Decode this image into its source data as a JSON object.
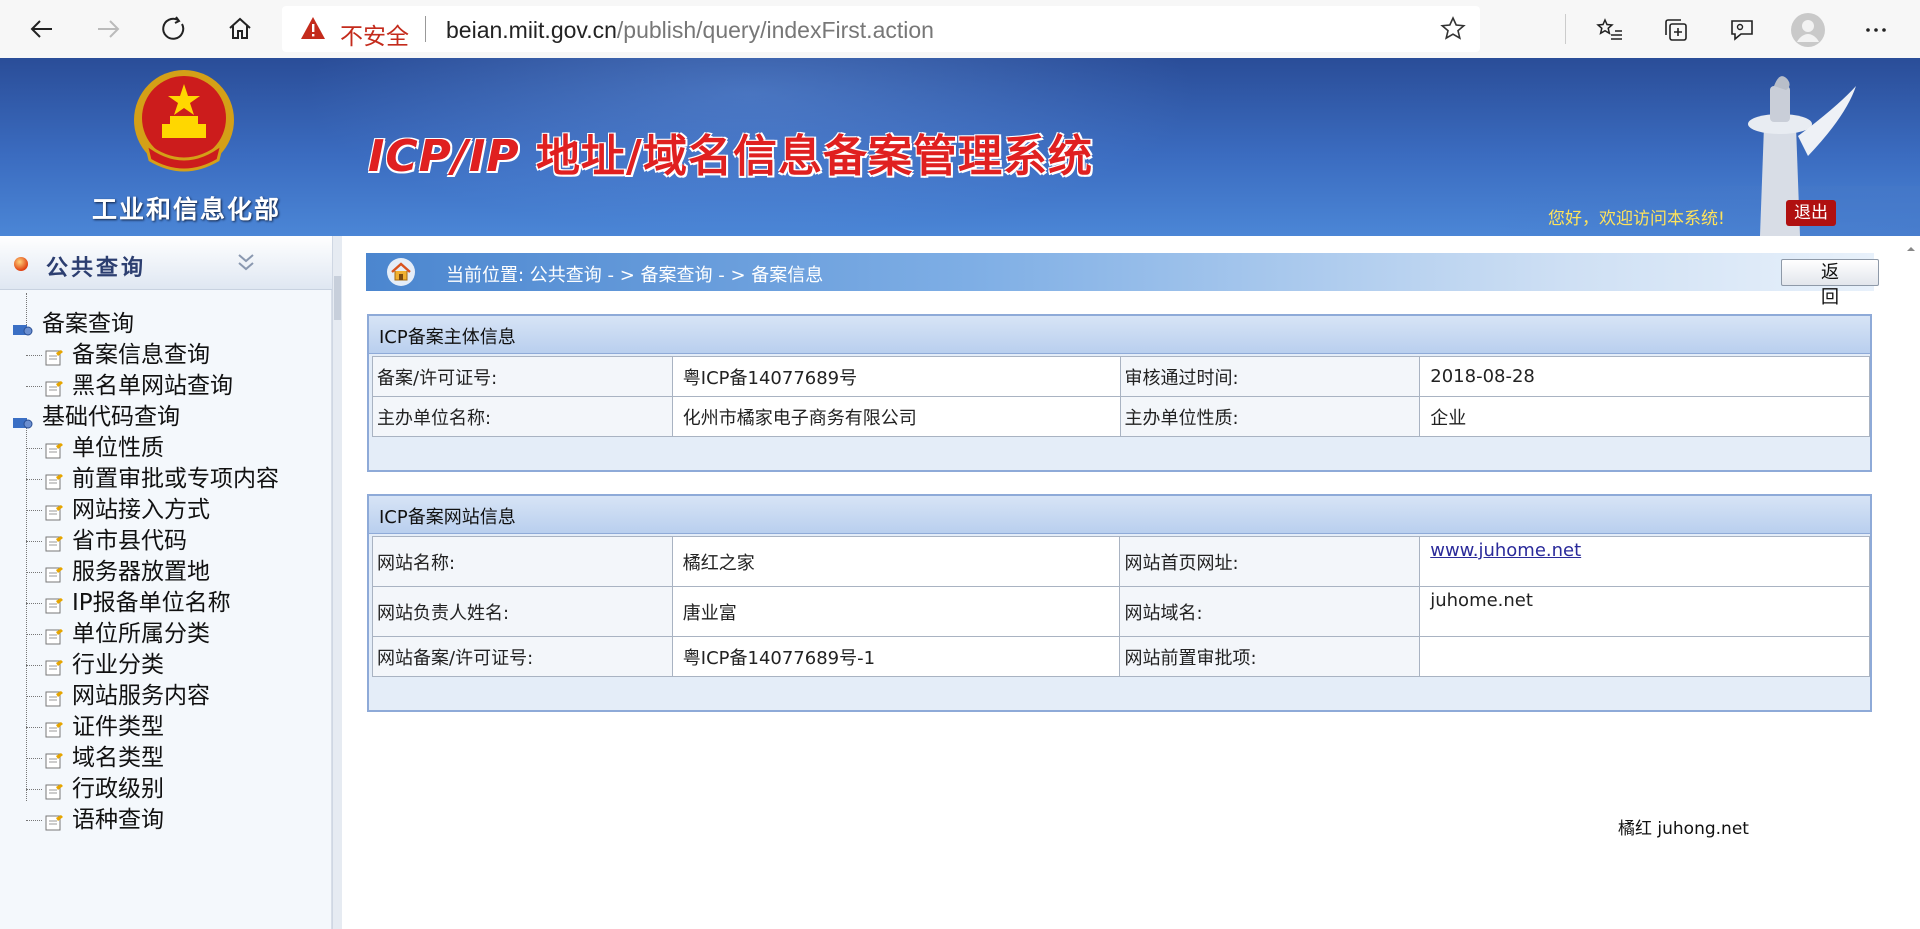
{
  "browser": {
    "security_label": "不安全",
    "url_host": "beian.miit.gov.cn",
    "url_path": "/publish/query/indexFirst.action",
    "icons": [
      "back-icon",
      "forward-icon",
      "refresh-icon",
      "home-icon",
      "warning-icon",
      "favorite-star-icon",
      "favorites-list-icon",
      "collections-icon",
      "feedback-icon",
      "profile-icon",
      "more-icon"
    ]
  },
  "header": {
    "ministry": "工业和信息化部",
    "system_title_latin": "ICP/IP",
    "system_title_cn": "地址/域名信息备案管理系统",
    "welcome": "您好，欢迎访问本系统!",
    "logout": "退出"
  },
  "sidebar": {
    "title": "公共查询",
    "groups": [
      {
        "label": "备案查询",
        "items": [
          "备案信息查询",
          "黑名单网站查询"
        ]
      },
      {
        "label": "基础代码查询",
        "items": [
          "单位性质",
          "前置审批或专项内容",
          "网站接入方式",
          "省市县代码",
          "服务器放置地",
          "IP报备单位名称",
          "单位所属分类",
          "行业分类",
          "网站服务内容",
          "证件类型",
          "域名类型",
          "行政级别",
          "语种查询"
        ]
      }
    ]
  },
  "breadcrumb": {
    "text": "当前位置:  公共查询   - >  备案查询   - >  备案信息",
    "back_button": "返 回"
  },
  "subject_panel": {
    "title": "ICP备案主体信息",
    "rows": [
      [
        "备案/许可证号:",
        "粤ICP备14077689号",
        "审核通过时间:",
        "2018-08-28"
      ],
      [
        "主办单位名称:",
        "化州市橘家电子商务有限公司",
        "主办单位性质:",
        "企业"
      ]
    ]
  },
  "website_panel": {
    "title": "ICP备案网站信息",
    "rows": [
      [
        "网站名称:",
        "橘红之家",
        "网站首页网址:",
        "www.juhome.net"
      ],
      [
        "网站负责人姓名:",
        "唐业富",
        "网站域名:",
        "juhome.net"
      ],
      [
        "网站备案/许可证号:",
        "粤ICP备14077689号-1",
        "网站前置审批项:",
        ""
      ]
    ]
  },
  "footer": {
    "credit": "橘红 juhong.net"
  },
  "colors": {
    "banner": "#3b6cc0",
    "title_red": "#e02020",
    "welcome_yellow": "#ffe35a",
    "logout_red": "#b01010",
    "panel_border": "#8eaad8"
  }
}
